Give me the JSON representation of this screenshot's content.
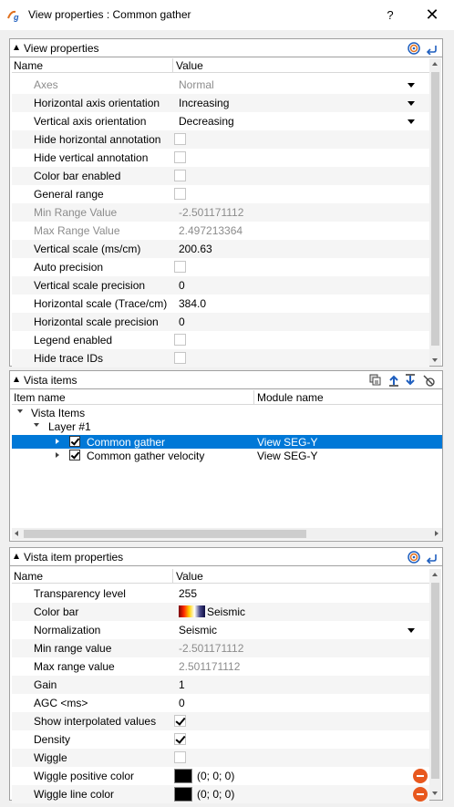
{
  "window": {
    "title": "View properties : Common gather",
    "help_label": "?",
    "close_label": "✕"
  },
  "view_properties": {
    "title": "View properties",
    "columns": [
      "Name",
      "Value"
    ],
    "rows": [
      {
        "name": "Axes",
        "value": "Normal",
        "type": "dropdown",
        "disabled": true
      },
      {
        "name": "Horizontal axis orientation",
        "value": "Increasing",
        "type": "dropdown"
      },
      {
        "name": "Vertical axis orientation",
        "value": "Decreasing",
        "type": "dropdown"
      },
      {
        "name": "Hide horizontal annotation",
        "value": false,
        "type": "checkbox"
      },
      {
        "name": "Hide vertical annotation",
        "value": false,
        "type": "checkbox"
      },
      {
        "name": "Color bar enabled",
        "value": false,
        "type": "checkbox"
      },
      {
        "name": "General range",
        "value": false,
        "type": "checkbox"
      },
      {
        "name": "Min Range Value",
        "value": "-2.501171112",
        "type": "text",
        "disabled": true
      },
      {
        "name": "Max Range Value",
        "value": "2.497213364",
        "type": "text",
        "disabled": true
      },
      {
        "name": "Vertical scale (ms/cm)",
        "value": "200.63",
        "type": "text"
      },
      {
        "name": "Auto precision",
        "value": false,
        "type": "checkbox"
      },
      {
        "name": "Vertical scale precision",
        "value": "0",
        "type": "text"
      },
      {
        "name": "Horizontal scale (Trace/cm)",
        "value": "384.0",
        "type": "text"
      },
      {
        "name": "Horizontal scale precision",
        "value": "0",
        "type": "text"
      },
      {
        "name": "Legend enabled",
        "value": false,
        "type": "checkbox"
      },
      {
        "name": "Hide trace IDs",
        "value": false,
        "type": "checkbox"
      }
    ]
  },
  "vista_items": {
    "title": "Vista items",
    "columns": [
      "Item name",
      "Module name"
    ],
    "root": "Vista Items",
    "layer": "Layer #1",
    "items": [
      {
        "name": "Common gather",
        "module": "View SEG-Y",
        "checked": true,
        "selected": true
      },
      {
        "name": "Common gather velocity",
        "module": "View SEG-Y",
        "checked": true,
        "selected": false
      }
    ]
  },
  "vista_item_properties": {
    "title": "Vista item properties",
    "columns": [
      "Name",
      "Value"
    ],
    "rows": [
      {
        "name": "Transparency level",
        "value": "255",
        "type": "text"
      },
      {
        "name": "Color bar",
        "value": "Seismic",
        "type": "colorbar"
      },
      {
        "name": "Normalization",
        "value": "Seismic",
        "type": "dropdown"
      },
      {
        "name": "Min range value",
        "value": "-2.501171112",
        "type": "text",
        "disabled_value": true
      },
      {
        "name": "Max range value",
        "value": "2.501171112",
        "type": "text",
        "disabled_value": true
      },
      {
        "name": "Gain",
        "value": "1",
        "type": "text"
      },
      {
        "name": "AGC <ms>",
        "value": "0",
        "type": "text"
      },
      {
        "name": "Show interpolated values",
        "value": true,
        "type": "checkbox"
      },
      {
        "name": "Density",
        "value": true,
        "type": "checkbox"
      },
      {
        "name": "Wiggle",
        "value": false,
        "type": "checkbox"
      },
      {
        "name": "Wiggle positive color",
        "value": "(0; 0; 0)",
        "type": "color"
      },
      {
        "name": "Wiggle line color",
        "value": "(0; 0; 0)",
        "type": "color"
      }
    ]
  },
  "colors": {
    "selection": "#0078d7",
    "accent_blue": "#1f5fbf",
    "remove_button": "#e8581e"
  }
}
